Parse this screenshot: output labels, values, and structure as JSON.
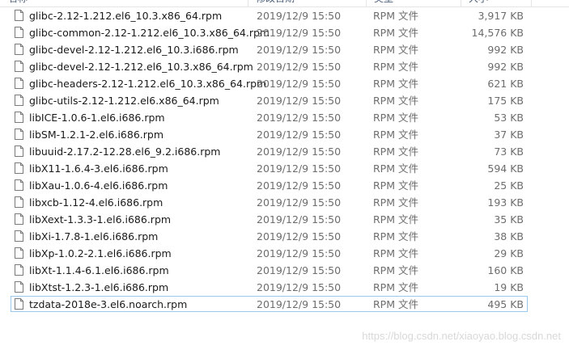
{
  "header": {
    "name": "名称",
    "date": "修改日期",
    "type": "类型",
    "size": "大小"
  },
  "files": [
    {
      "name": "glibc-2.12-1.212.el6_10.3.x86_64.rpm",
      "date": "2019/12/9 15:50",
      "type": "RPM 文件",
      "size": "3,917 KB"
    },
    {
      "name": "glibc-common-2.12-1.212.el6_10.3.x86_64.rpm",
      "date": "2019/12/9 15:50",
      "type": "RPM 文件",
      "size": "14,576 KB"
    },
    {
      "name": "glibc-devel-2.12-1.212.el6_10.3.i686.rpm",
      "date": "2019/12/9 15:50",
      "type": "RPM 文件",
      "size": "992 KB"
    },
    {
      "name": "glibc-devel-2.12-1.212.el6_10.3.x86_64.rpm",
      "date": "2019/12/9 15:50",
      "type": "RPM 文件",
      "size": "992 KB"
    },
    {
      "name": "glibc-headers-2.12-1.212.el6_10.3.x86_64.rpm",
      "date": "2019/12/9 15:50",
      "type": "RPM 文件",
      "size": "621 KB"
    },
    {
      "name": "glibc-utils-2.12-1.212.el6.x86_64.rpm",
      "date": "2019/12/9 15:50",
      "type": "RPM 文件",
      "size": "175 KB"
    },
    {
      "name": "libICE-1.0.6-1.el6.i686.rpm",
      "date": "2019/12/9 15:50",
      "type": "RPM 文件",
      "size": "53 KB"
    },
    {
      "name": "libSM-1.2.1-2.el6.i686.rpm",
      "date": "2019/12/9 15:50",
      "type": "RPM 文件",
      "size": "37 KB"
    },
    {
      "name": "libuuid-2.17.2-12.28.el6_9.2.i686.rpm",
      "date": "2019/12/9 15:50",
      "type": "RPM 文件",
      "size": "73 KB"
    },
    {
      "name": "libX11-1.6.4-3.el6.i686.rpm",
      "date": "2019/12/9 15:50",
      "type": "RPM 文件",
      "size": "594 KB"
    },
    {
      "name": "libXau-1.0.6-4.el6.i686.rpm",
      "date": "2019/12/9 15:50",
      "type": "RPM 文件",
      "size": "25 KB"
    },
    {
      "name": "libxcb-1.12-4.el6.i686.rpm",
      "date": "2019/12/9 15:50",
      "type": "RPM 文件",
      "size": "193 KB"
    },
    {
      "name": "libXext-1.3.3-1.el6.i686.rpm",
      "date": "2019/12/9 15:50",
      "type": "RPM 文件",
      "size": "35 KB"
    },
    {
      "name": "libXi-1.7.8-1.el6.i686.rpm",
      "date": "2019/12/9 15:50",
      "type": "RPM 文件",
      "size": "38 KB"
    },
    {
      "name": "libXp-1.0.2-2.1.el6.i686.rpm",
      "date": "2019/12/9 15:50",
      "type": "RPM 文件",
      "size": "29 KB"
    },
    {
      "name": "libXt-1.1.4-6.1.el6.i686.rpm",
      "date": "2019/12/9 15:50",
      "type": "RPM 文件",
      "size": "160 KB"
    },
    {
      "name": "libXtst-1.2.3-1.el6.i686.rpm",
      "date": "2019/12/9 15:50",
      "type": "RPM 文件",
      "size": "19 KB"
    },
    {
      "name": "tzdata-2018e-3.el6.noarch.rpm",
      "date": "2019/12/9 15:50",
      "type": "RPM 文件",
      "size": "495 KB",
      "focused": true
    }
  ],
  "icon": "file-icon",
  "watermark": "https://blog.csdn.net/xiaoyao.blog.csdn.net"
}
